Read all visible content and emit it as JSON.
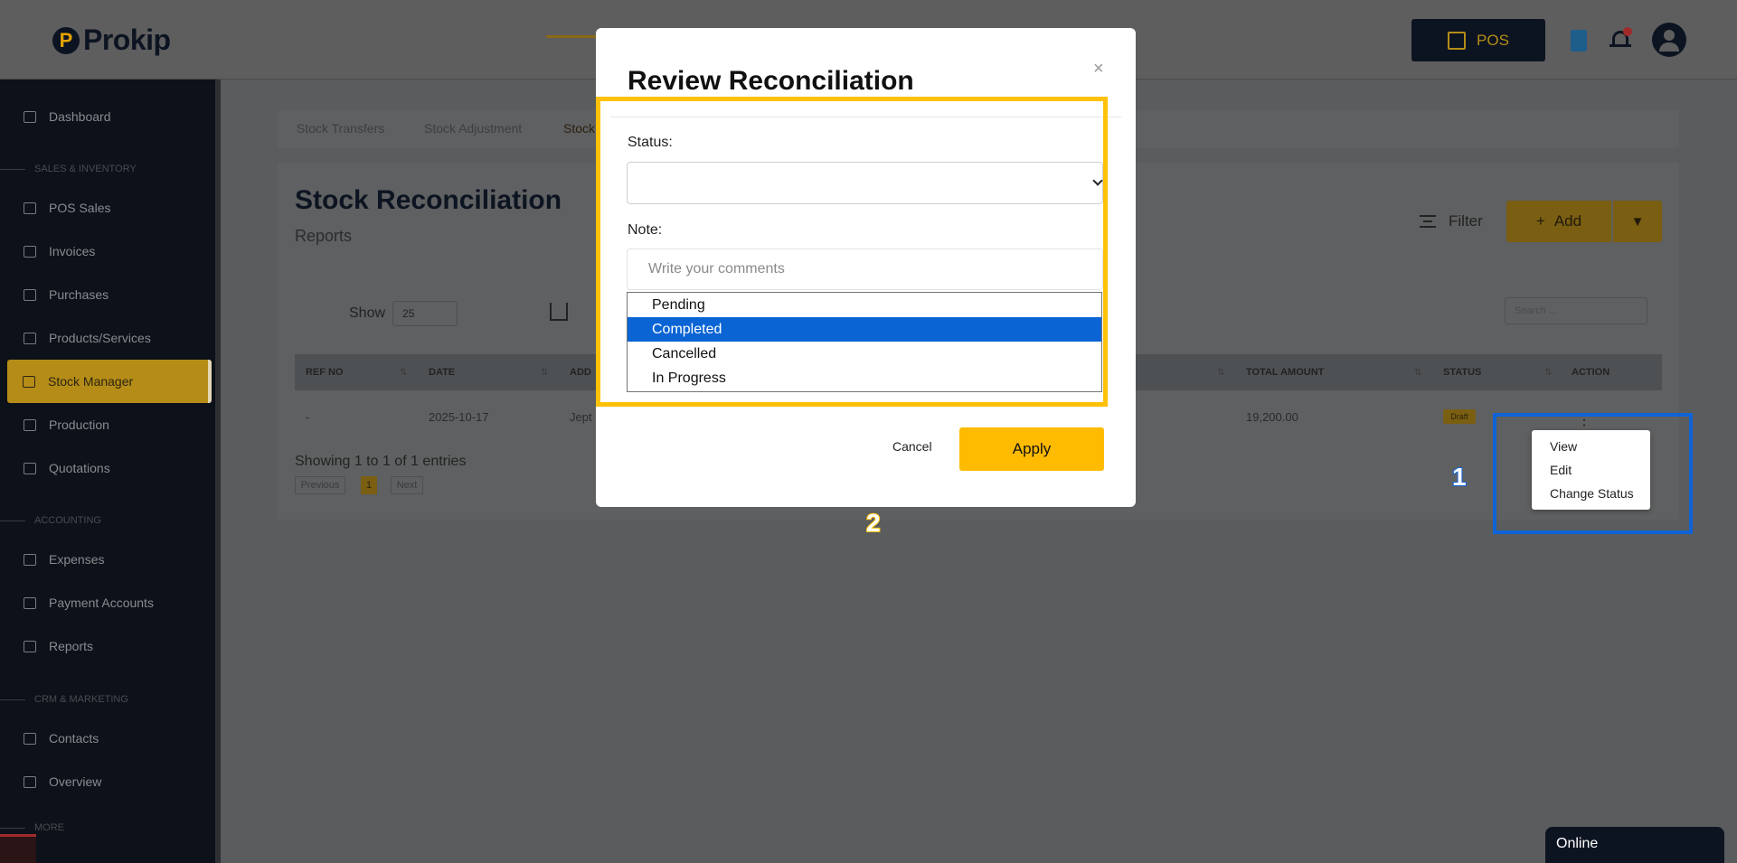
{
  "app": {
    "logo_mark": "P",
    "logo_text": "Prokip"
  },
  "header": {
    "pos_label": "POS",
    "notification_count": "1"
  },
  "sidebar": {
    "items": [
      {
        "label": "Dashboard",
        "icon": "home-icon"
      },
      {
        "section": "SALES & INVENTORY"
      },
      {
        "label": "POS Sales",
        "icon": "cart-icon"
      },
      {
        "label": "Invoices",
        "icon": "invoice-icon"
      },
      {
        "label": "Purchases",
        "icon": "purchase-icon"
      },
      {
        "label": "Products/Services",
        "icon": "box-icon"
      },
      {
        "label": "Stock Manager",
        "icon": "stock-icon",
        "active": true
      },
      {
        "label": "Production",
        "icon": "factory-icon"
      },
      {
        "label": "Quotations",
        "icon": "quote-icon"
      },
      {
        "section": "ACCOUNTING"
      },
      {
        "label": "Expenses",
        "icon": "expense-icon"
      },
      {
        "label": "Payment Accounts",
        "icon": "wallet-icon"
      },
      {
        "label": "Reports",
        "icon": "report-icon"
      },
      {
        "section": "CRM & MARKETING"
      },
      {
        "label": "Contacts",
        "icon": "contacts-icon"
      },
      {
        "label": "Overview",
        "icon": "overview-icon"
      },
      {
        "section": "MORE"
      }
    ]
  },
  "tabs": [
    "Stock Transfers",
    "Stock Adjustment",
    "Stock"
  ],
  "page": {
    "title": "Stock Reconciliation",
    "subtitle": "Reports",
    "filter_label": "Filter",
    "add_label": "Add",
    "show_label": "Show",
    "show_value": "25",
    "search_placeholder": "Search ...",
    "entries_text": "Showing 1 to 1 of 1 entries",
    "pager": {
      "prev": "Previous",
      "current": "1",
      "next": "Next"
    }
  },
  "table": {
    "columns": [
      "REF NO",
      "DATE",
      "ADD",
      "TOTAL AMOUNT",
      "STATUS",
      "ACTION"
    ],
    "rows": [
      {
        "ref_no": "-",
        "date": "2025-10-17",
        "added_by": "Jept",
        "total_amount": "19,200.00",
        "status": "Draft"
      }
    ]
  },
  "action_menu": {
    "items": [
      "View",
      "Edit",
      "Change Status"
    ],
    "marker": "1"
  },
  "modal": {
    "title": "Review Reconciliation",
    "close": "×",
    "status_label": "Status:",
    "status_value": "",
    "note_label": "Note:",
    "note_placeholder": "Write your comments",
    "status_options": [
      "Pending",
      "Completed",
      "Cancelled",
      "In Progress"
    ],
    "highlighted_option": "Completed",
    "cancel_label": "Cancel",
    "apply_label": "Apply",
    "marker": "2"
  },
  "chat": {
    "status": "Online"
  },
  "colors": {
    "accent": "#ffbb00",
    "sidebar_bg": "#0c111a",
    "selection": "#0a64d4",
    "highlight_blue": "#0f63d6",
    "highlight_yellow": "#ffc107"
  }
}
